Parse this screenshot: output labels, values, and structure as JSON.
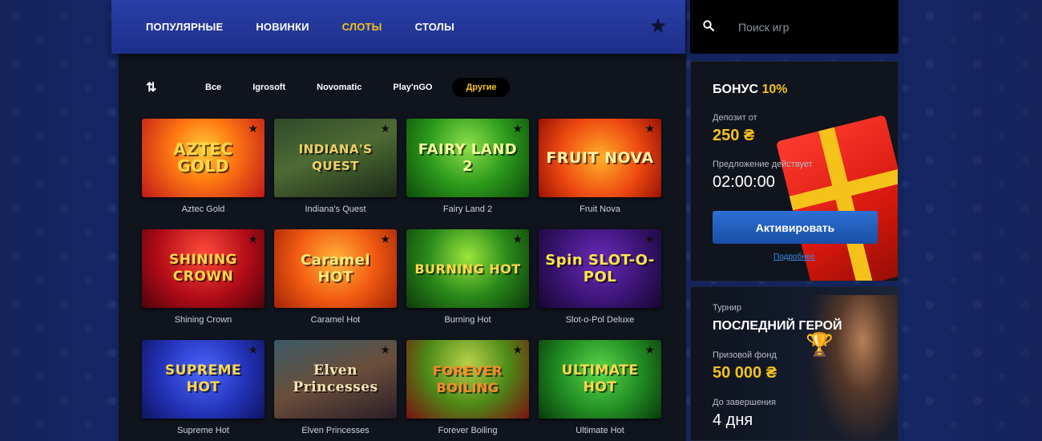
{
  "nav": {
    "tabs": [
      {
        "label": "Популярные"
      },
      {
        "label": "Новинки"
      },
      {
        "label": "Слоты"
      },
      {
        "label": "Столы"
      }
    ],
    "active_tab": "Слоты"
  },
  "search": {
    "placeholder": "Поиск игр"
  },
  "filters": {
    "items": [
      "Все",
      "Igrosoft",
      "Novomatic",
      "Play'nGO",
      "Другие"
    ],
    "active": "Другие"
  },
  "games": [
    {
      "name": "Aztec Gold",
      "logo": "AZTEC GOLD"
    },
    {
      "name": "Indiana's Quest",
      "logo": "INDIANA'S QUEST"
    },
    {
      "name": "Fairy Land 2",
      "logo": "FAIRY LAND 2"
    },
    {
      "name": "Fruit Nova",
      "logo": "FRUIT NOVA"
    },
    {
      "name": "Shining Crown",
      "logo": "SHINING CROWN"
    },
    {
      "name": "Caramel Hot",
      "logo": "Caramel HOT"
    },
    {
      "name": "Burning Hot",
      "logo": "BURNING HOT"
    },
    {
      "name": "Slot-o-Pol Deluxe",
      "logo": "Spin SLOT-O-POL"
    },
    {
      "name": "Supreme Hot",
      "logo": "SUPREME HOT"
    },
    {
      "name": "Elven Princesses",
      "logo": "Elven Princesses"
    },
    {
      "name": "Forever Boiling",
      "logo": "FOREVER BOILING"
    },
    {
      "name": "Ultimate Hot",
      "logo": "ULTIMATE HOT"
    }
  ],
  "bonus": {
    "title": "Бонус",
    "percent": "10%",
    "deposit_label": "Депозит от",
    "deposit_value": "250 ₴",
    "offer_label": "Предложение действует",
    "offer_timer": "02:00:00",
    "activate_label": "Активировать",
    "more_label": "Подробнее"
  },
  "tournament": {
    "kicker": "Турнир",
    "title": "Последний герой",
    "prize_label": "Призовой фонд",
    "prize_value": "50 000 ₴",
    "ends_label": "До завершения",
    "ends_value": "4 дня"
  },
  "colors": {
    "accent_gold": "#f5c21b",
    "nav_blue": "#2a3fa8",
    "button_blue": "#2c6fd4",
    "link_blue": "#3c8ee5"
  }
}
